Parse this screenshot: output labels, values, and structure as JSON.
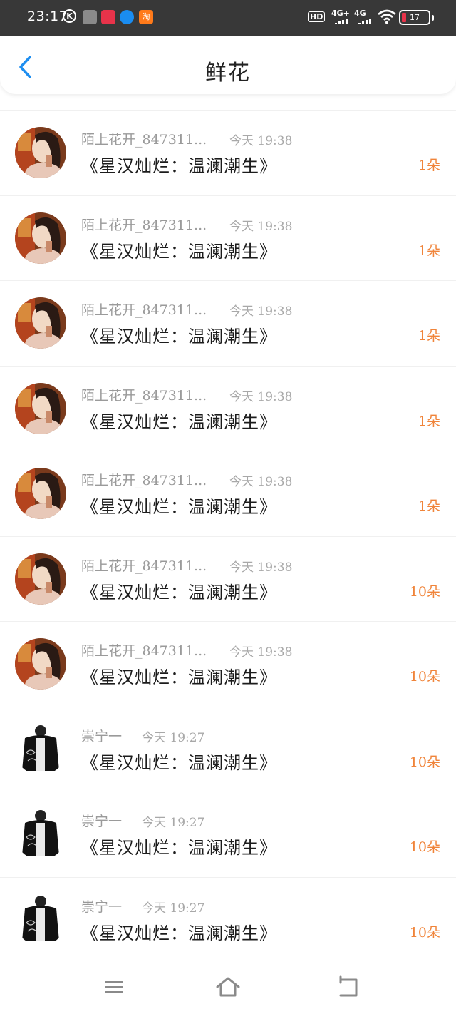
{
  "status_bar": {
    "time": "23:17",
    "k_icon": "K",
    "app_icons": [
      "app-icon-gray",
      "app-icon-xiaohongshu",
      "app-icon-blue",
      "taobao-icon"
    ],
    "app4_glyph": "淘",
    "hd": "HD",
    "net_a": "4G+",
    "net_b": "4G",
    "battery": "17"
  },
  "header": {
    "title": "鲜花",
    "back_icon": "chevron-left-icon"
  },
  "colors": {
    "accent_blue": "#1e8ef0",
    "count_orange": "#f0843a",
    "status_bg": "#383838"
  },
  "gifts": [
    {
      "user": "陌上花开_847311...",
      "time": "今天 19:38",
      "book": "《星汉灿烂：温澜潮生》",
      "count": "1朵",
      "avatar": "girl"
    },
    {
      "user": "陌上花开_847311...",
      "time": "今天 19:38",
      "book": "《星汉灿烂：温澜潮生》",
      "count": "1朵",
      "avatar": "girl"
    },
    {
      "user": "陌上花开_847311...",
      "time": "今天 19:38",
      "book": "《星汉灿烂：温澜潮生》",
      "count": "1朵",
      "avatar": "girl"
    },
    {
      "user": "陌上花开_847311...",
      "time": "今天 19:38",
      "book": "《星汉灿烂：温澜潮生》",
      "count": "1朵",
      "avatar": "girl"
    },
    {
      "user": "陌上花开_847311...",
      "time": "今天 19:38",
      "book": "《星汉灿烂：温澜潮生》",
      "count": "1朵",
      "avatar": "girl"
    },
    {
      "user": "陌上花开_847311...",
      "time": "今天 19:38",
      "book": "《星汉灿烂：温澜潮生》",
      "count": "10朵",
      "avatar": "girl"
    },
    {
      "user": "陌上花开_847311...",
      "time": "今天 19:38",
      "book": "《星汉灿烂：温澜潮生》",
      "count": "10朵",
      "avatar": "girl"
    },
    {
      "user": "崇宁一",
      "time": "今天 19:27",
      "book": "《星汉灿烂：温澜潮生》",
      "count": "10朵",
      "avatar": "robe"
    },
    {
      "user": "崇宁一",
      "time": "今天 19:27",
      "book": "《星汉灿烂：温澜潮生》",
      "count": "10朵",
      "avatar": "robe"
    },
    {
      "user": "崇宁一",
      "time": "今天 19:27",
      "book": "《星汉灿烂：温澜潮生》",
      "count": "10朵",
      "avatar": "robe"
    }
  ],
  "bottom_nav": [
    "menu-icon",
    "home-icon",
    "back-icon"
  ]
}
